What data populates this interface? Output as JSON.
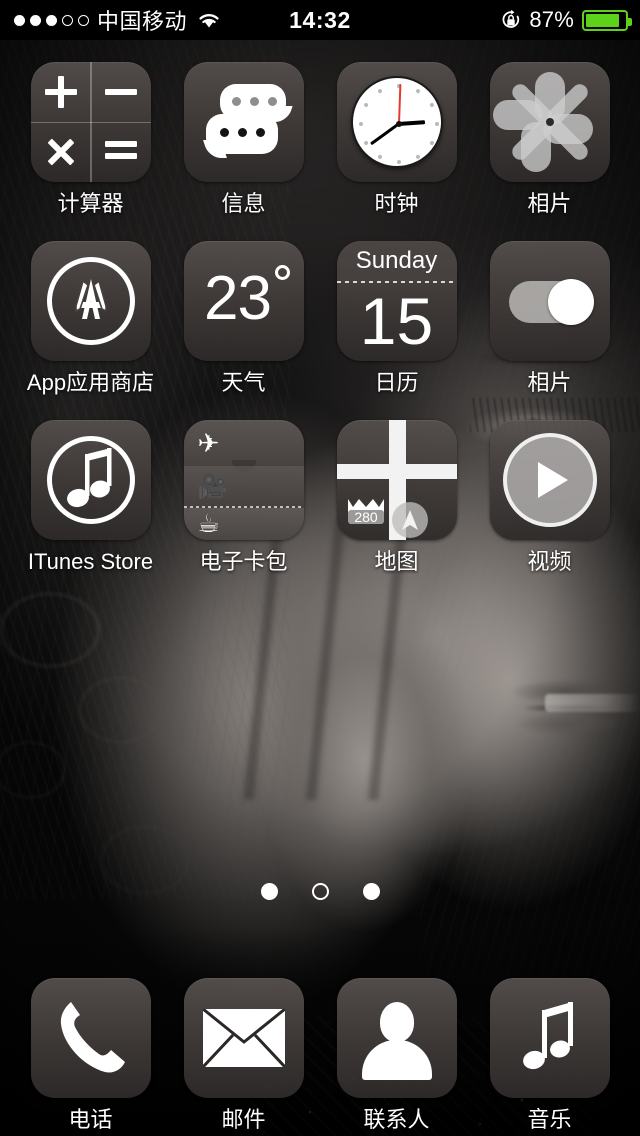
{
  "status_bar": {
    "signal_dots_filled": 3,
    "signal_dots_total": 5,
    "carrier": "中国移动",
    "wifi_icon": "wifi-icon",
    "time": "14:32",
    "rotation_lock_icon": "rotation-lock-icon",
    "battery_percent": "87%",
    "battery_level": 87,
    "battery_color": "#5ed11a"
  },
  "home_screen": {
    "rows": [
      {
        "apps": [
          {
            "label": "计算器",
            "icon": "calculator-icon",
            "latin": false,
            "ops": {
              "plus": "+",
              "minus": "−",
              "times": "×",
              "equals": "="
            }
          },
          {
            "label": "信息",
            "icon": "messages-icon",
            "latin": false
          },
          {
            "label": "时钟",
            "icon": "clock-icon",
            "latin": false,
            "clock": {
              "hour_angle": 86,
              "minute_angle": 234,
              "second_angle": 2,
              "second_hand_color": "#e03b2c"
            }
          },
          {
            "label": "相片",
            "icon": "photos-flower-icon",
            "latin": false
          }
        ]
      },
      {
        "apps": [
          {
            "label": "App应用商店",
            "icon": "app-store-icon",
            "latin": false
          },
          {
            "label": "天气",
            "icon": "weather-icon",
            "latin": false,
            "temperature": "23"
          },
          {
            "label": "日历",
            "icon": "calendar-icon",
            "latin": false,
            "calendar": {
              "weekday": "Sunday",
              "date": "15"
            }
          },
          {
            "label": "相片",
            "icon": "toggle-switch-icon",
            "latin": false,
            "toggle_state": "on"
          }
        ]
      },
      {
        "apps": [
          {
            "label": "ITunes Store",
            "icon": "itunes-store-icon",
            "latin": true
          },
          {
            "label": "电子卡包",
            "icon": "passbook-icon",
            "latin": false,
            "cards": [
              "airplane-icon",
              "movie-camera-icon",
              "coffee-cup-icon"
            ]
          },
          {
            "label": "地图",
            "icon": "maps-icon",
            "latin": false,
            "highway_shield": "280"
          },
          {
            "label": "视频",
            "icon": "videos-icon",
            "latin": false
          }
        ]
      }
    ]
  },
  "page_dots": {
    "count": 3,
    "styles": [
      "filled",
      "hollow",
      "filled"
    ]
  },
  "dock": {
    "apps": [
      {
        "label": "电话",
        "icon": "phone-icon"
      },
      {
        "label": "邮件",
        "icon": "mail-envelope-icon"
      },
      {
        "label": "联系人",
        "icon": "contacts-person-icon"
      },
      {
        "label": "音乐",
        "icon": "music-note-icon"
      }
    ]
  },
  "colors": {
    "icon_tint": "#56504e",
    "label_text": "#ffffff",
    "battery_green": "#5ed11a",
    "clock_second_hand": "#e03b2c"
  }
}
